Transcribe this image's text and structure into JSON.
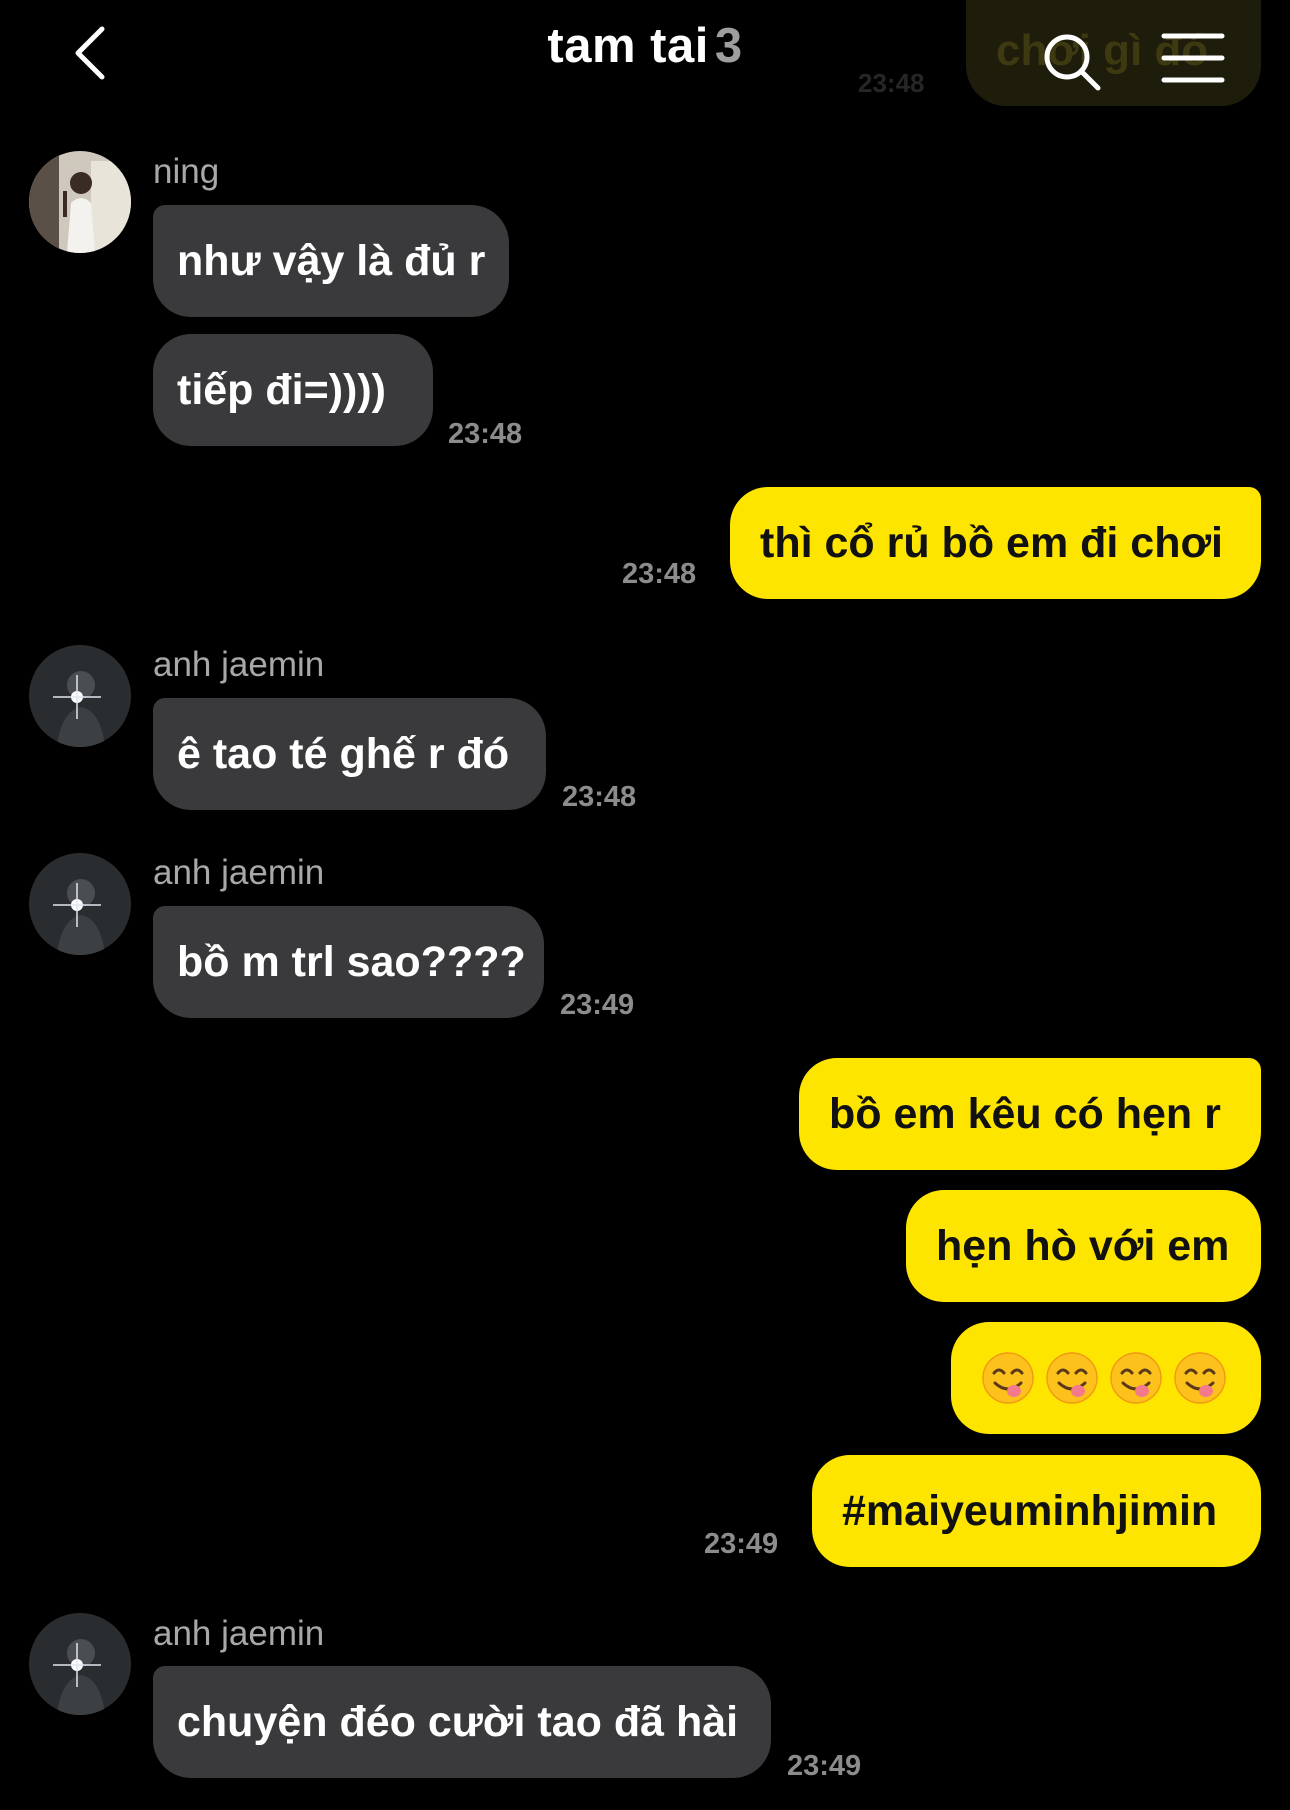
{
  "header": {
    "title": "tam tai",
    "member_count": "3",
    "pinned_preview": "chơi gì đó",
    "pinned_time": "23:48"
  },
  "icons": {
    "back": "chevron-left-icon",
    "search": "search-icon",
    "menu": "hamburger-menu-icon",
    "emoji": "face-savoring-food-emoji"
  },
  "colors": {
    "background": "#000000",
    "incoming_bubble": "#3a3a3c",
    "outgoing_bubble": "#fee500",
    "timestamp": "#8c8c8c"
  },
  "messages": [
    {
      "sender": "ning",
      "text": "như vậy là đủ r"
    },
    {
      "text": "tiếp đi=))))",
      "time": "23:48"
    },
    {
      "text": "thì cổ rủ bồ em đi chơi",
      "time": "23:48"
    },
    {
      "sender": "anh jaemin",
      "text": "ê tao té ghế r đó",
      "time": "23:48"
    },
    {
      "sender": "anh jaemin",
      "text": "bồ m trl sao????",
      "time": "23:49"
    },
    {
      "text": "bồ em kêu có hẹn r"
    },
    {
      "text": "hẹn hò với em"
    },
    {
      "emoji": "😋",
      "count": 4
    },
    {
      "text": "#maiyeuminhjimin",
      "time": "23:49"
    },
    {
      "sender": "anh jaemin",
      "text": "chuyện đéo cười tao đã hài",
      "time": "23:49"
    }
  ]
}
